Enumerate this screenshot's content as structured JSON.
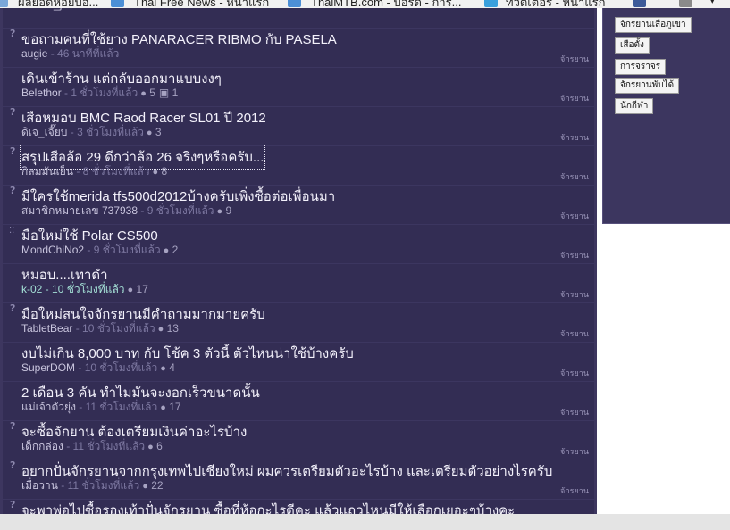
{
  "bookmarks": [
    {
      "label": "ผลยอดหอยบอ...",
      "icon": "bookmark-icon"
    },
    {
      "label": "Thai Free News - หนาแรก",
      "icon": "thaifree-favicon"
    },
    {
      "label": "ThaiMTB.com - บอร์ด - การ...",
      "icon": "thaimtb-favicon"
    },
    {
      "label": "ทวิตเตอร์ - หน้าแรก",
      "icon": "twitter-favicon"
    },
    {
      "label": "",
      "icon": "rss-icon"
    }
  ],
  "topics": [
    {
      "title": "ขอถามคนที่ใช้ยาง PANARACER RIBMO กับ PASELA",
      "author": "augie",
      "time": "46 นาทีที่แล้ว",
      "replies": "",
      "views": "",
      "category": "จักรยาน",
      "marker": "question"
    },
    {
      "title": "เดินเข้าร้าน แต่กลับออกมาแบบงงๆ",
      "author": "Belethor",
      "time": "1 ชั่วโมงที่แล้ว",
      "replies": "5",
      "views": "1",
      "category": "จักรยาน",
      "marker": "none"
    },
    {
      "title": "เสือหมอบ BMC Raod Racer SL01 ปี 2012",
      "author": "ดิเจ_เจี๊ยบ",
      "time": "3 ชั่วโมงที่แล้ว",
      "replies": "3",
      "views": "",
      "category": "จักรยาน",
      "marker": "question"
    },
    {
      "title": "สรุปเสือล้อ 29 ดีกว่าล้อ 26 จริงๆหรือครับ...",
      "author": "กิลมมันเย็น",
      "time": "8 ชั่วโมงที่แล้ว",
      "replies": "8",
      "views": "",
      "category": "จักรยาน",
      "marker": "question"
    },
    {
      "title": "มีใครใช้merida tfs500d2012บ้างครับเพิ่งซื้อต่อเพื่อนมา",
      "author": "สมาชิกหมายเลข 737938",
      "time": "9 ชั่วโมงที่แล้ว",
      "replies": "9",
      "views": "",
      "category": "จักรยาน",
      "marker": "question"
    },
    {
      "title": "มือใหม่ใช้ Polar CS500",
      "author": "MondChiNo2",
      "time": "9 ชั่วโมงที่แล้ว",
      "replies": "2",
      "views": "",
      "category": "จักรยาน",
      "marker": "pin"
    },
    {
      "title": "หมอบ....เทาดำ",
      "author": "k-02",
      "time": "10 ชั่วโมงที่แล้ว",
      "replies": "17",
      "views": "",
      "category": "จักรยาน",
      "marker": "none"
    },
    {
      "title": "มือใหม่สนใจจักรยานมีคำถามมากมายครับ",
      "author": "TabletBear",
      "time": "10 ชั่วโมงที่แล้ว",
      "replies": "13",
      "views": "",
      "category": "จักรยาน",
      "marker": "question"
    },
    {
      "title": "งบไม่เกิน 8,000 บาท กับ โช้ค 3 ตัวนี้ ตัวไหนน่าใช้บ้างครับ",
      "author": "SuperDOM",
      "time": "10 ชั่วโมงที่แล้ว",
      "replies": "4",
      "views": "",
      "category": "จักรยาน",
      "marker": "none"
    },
    {
      "title": "2 เดือน 3 คัน ทำไมมันจะงอกเร็วขนาดนั้น",
      "author": "แม่เจ้าตัวยุ่ง",
      "time": "11 ชั่วโมงที่แล้ว",
      "replies": "17",
      "views": "",
      "category": "จักรยาน",
      "marker": "none"
    },
    {
      "title": "จะซื้อจักยาน ต้องเตรียมเงินค่าอะไรบ้าง",
      "author": "เด็กกล่อง",
      "time": "11 ชั่วโมงที่แล้ว",
      "replies": "6",
      "views": "",
      "category": "จักรยาน",
      "marker": "question"
    },
    {
      "title": "อยากปั่นจักรยานจากกรุงเทพไปเชียงใหม่ ผมควรเตรียมตัวอะไรบ้าง และเตรียมตัวอย่างไรครับ",
      "author": "เมื่อวาน",
      "time": "11 ชั่วโมงที่แล้ว",
      "replies": "22",
      "views": "",
      "category": "จักรยาน",
      "marker": "question"
    },
    {
      "title": "จะพาพ่อไปซื้อรองเท้าปั่นจักรยาน ซื้อที่ห้อกะไรดีคะ แล้วแถวไหนมีให้เลือกเยอะๆบ้างคะ",
      "author": "",
      "time": "",
      "replies": "",
      "views": "",
      "category": "",
      "marker": "question"
    }
  ],
  "sidebar_tags": [
    "จักรยานเสือภูเขา",
    "เสือตั้ง",
    "การจราจร",
    "จักรยานพับได้",
    "นักกีฬา"
  ]
}
